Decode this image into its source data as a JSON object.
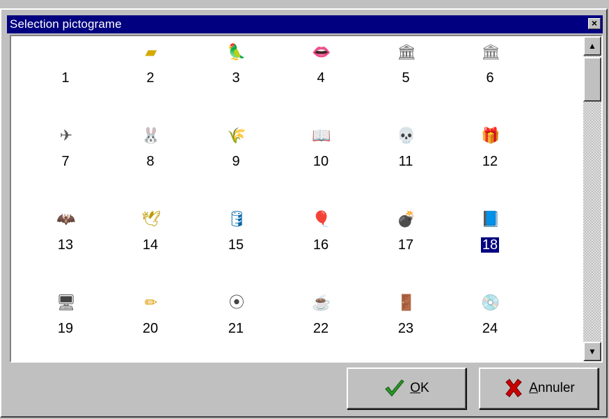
{
  "window": {
    "title": "Selection pictograme",
    "close_label": "×"
  },
  "icons": [
    {
      "number": "1",
      "icon": "blank-icon",
      "glyph": "",
      "color": "#000000"
    },
    {
      "number": "2",
      "icon": "eye-mask-icon",
      "glyph": "▰",
      "color": "#d4aa00"
    },
    {
      "number": "3",
      "icon": "parrot-icon",
      "glyph": "🦜",
      "color": "#333333"
    },
    {
      "number": "4",
      "icon": "lips-icon",
      "glyph": "👄",
      "color": "#cc0000"
    },
    {
      "number": "5",
      "icon": "column-icon",
      "glyph": "🏛",
      "color": "#666666"
    },
    {
      "number": "6",
      "icon": "ionic-column-icon",
      "glyph": "🏛",
      "color": "#777777"
    },
    {
      "number": "7",
      "icon": "rocket-icon",
      "glyph": "✈",
      "color": "#555555"
    },
    {
      "number": "8",
      "icon": "rabbit-icon",
      "glyph": "🐰",
      "color": "#888888"
    },
    {
      "number": "9",
      "icon": "leaf-icon",
      "glyph": "🌾",
      "color": "#886622"
    },
    {
      "number": "10",
      "icon": "open-book-icon",
      "glyph": "📖",
      "color": "#aa5533"
    },
    {
      "number": "11",
      "icon": "skull-head-icon",
      "glyph": "💀",
      "color": "#334433"
    },
    {
      "number": "12",
      "icon": "gift-box-icon",
      "glyph": "🎁",
      "color": "#cc3355"
    },
    {
      "number": "13",
      "icon": "bat-icon",
      "glyph": "🦇",
      "color": "#ccbb00"
    },
    {
      "number": "14",
      "icon": "bird-icon",
      "glyph": "🕊",
      "color": "#bb9900"
    },
    {
      "number": "15",
      "icon": "database-icon",
      "glyph": "🛢",
      "color": "#0066aa"
    },
    {
      "number": "16",
      "icon": "balloon-icon",
      "glyph": "🎈",
      "color": "#dd0000"
    },
    {
      "number": "17",
      "icon": "bomb-icon",
      "glyph": "💣",
      "color": "#333333"
    },
    {
      "number": "18",
      "icon": "book-stack-icon",
      "glyph": "📘",
      "color": "#222266",
      "selected": true
    },
    {
      "number": "19",
      "icon": "computer-monitor-icon",
      "glyph": "🖥",
      "color": "#444444"
    },
    {
      "number": "20",
      "icon": "pencil-icon",
      "glyph": "✏",
      "color": "#dd9900"
    },
    {
      "number": "21",
      "icon": "film-reel-icon",
      "glyph": "⦿",
      "color": "#444444"
    },
    {
      "number": "22",
      "icon": "coffee-cup-icon",
      "glyph": "☕",
      "color": "#333333"
    },
    {
      "number": "23",
      "icon": "red-door-icon",
      "glyph": "🚪",
      "color": "#dd0000"
    },
    {
      "number": "24",
      "icon": "compact-disc-icon",
      "glyph": "💿",
      "color": "#888888"
    }
  ],
  "buttons": {
    "ok_access": "O",
    "ok_rest": "K",
    "cancel_access": "A",
    "cancel_rest": "nnuler"
  },
  "colors": {
    "titlebar": "#000080",
    "selection": "#000080",
    "ok_check": "#2a9a2a",
    "cancel_x": "#cc0000"
  }
}
